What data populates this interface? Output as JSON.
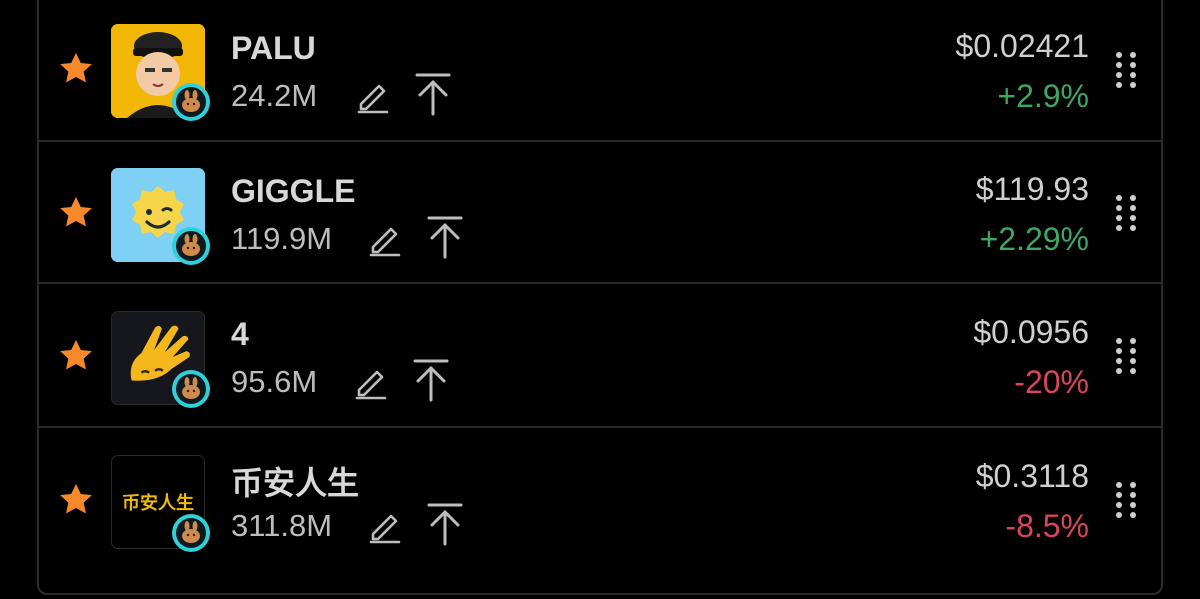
{
  "colors": {
    "background": "#000000",
    "star": "#f5892b",
    "positive": "#3fa765",
    "negative": "#d9455a",
    "badge": "#2fd0d8"
  },
  "tokens": [
    {
      "name": "PALU",
      "market_cap": "24.2M",
      "price": "$0.02421",
      "change": "+2.9%",
      "direction": "up",
      "logo_icon": "palu-character-icon",
      "logo_bg": "#f2b705"
    },
    {
      "name": "GIGGLE",
      "market_cap": "119.9M",
      "price": "$119.93",
      "change": "+2.29%",
      "direction": "up",
      "logo_icon": "giggle-smiley-icon",
      "logo_bg": "#7fd0f5"
    },
    {
      "name": "4",
      "market_cap": "95.6M",
      "price": "$0.0956",
      "change": "-20%",
      "direction": "down",
      "logo_icon": "four-hand-icon",
      "logo_bg": "#15171c"
    },
    {
      "name": "币安人生",
      "market_cap": "311.8M",
      "price": "$0.3118",
      "change": "-8.5%",
      "direction": "down",
      "logo_icon": "binance-life-text-logo",
      "logo_text": "币安人生",
      "logo_bg": "#000000"
    }
  ]
}
